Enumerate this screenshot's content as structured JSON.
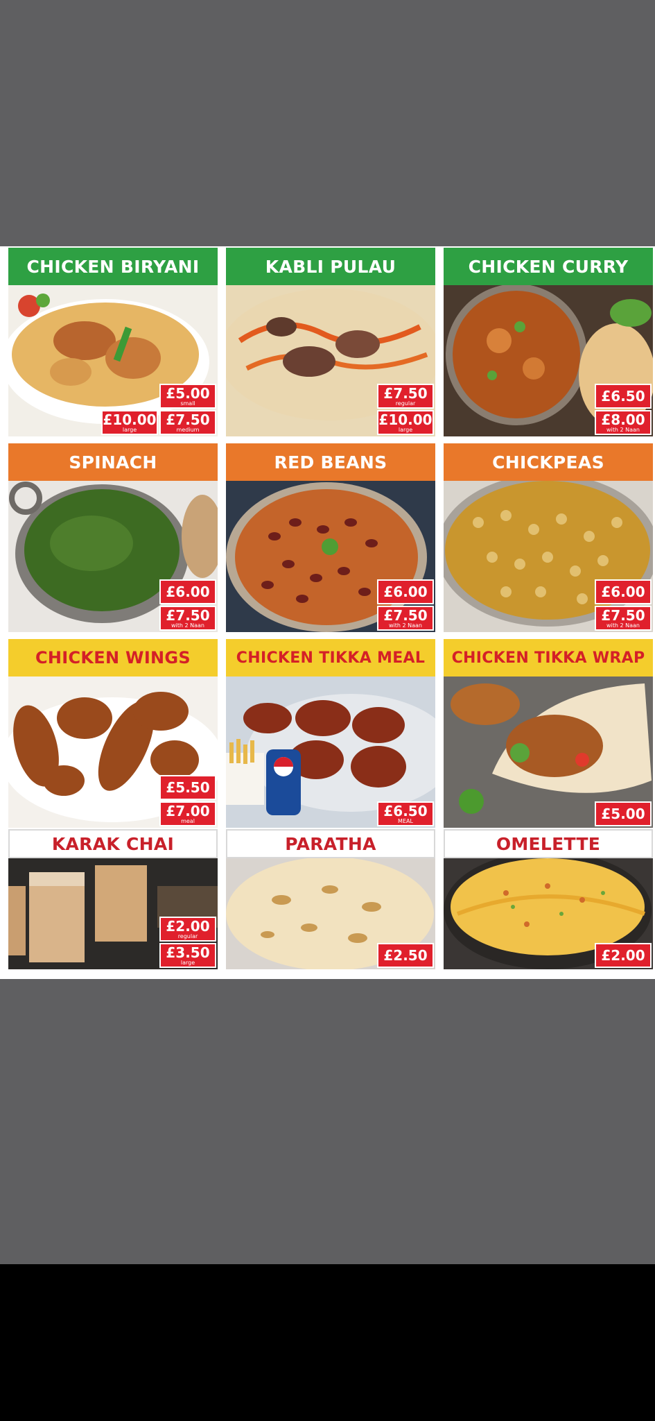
{
  "menu": {
    "items": [
      {
        "title": "CHICKEN BIRYANI",
        "prices": [
          {
            "amount": "£5.00",
            "note": "small"
          },
          {
            "amount": "£10.00",
            "note": "large"
          },
          {
            "amount": "£7.50",
            "note": "medium"
          }
        ]
      },
      {
        "title": "KABLI PULAU",
        "prices": [
          {
            "amount": "£7.50",
            "note": "regular"
          },
          {
            "amount": "£10.00",
            "note": "large"
          }
        ]
      },
      {
        "title": "CHICKEN CURRY",
        "prices": [
          {
            "amount": "£6.50",
            "note": ""
          },
          {
            "amount": "£8.00",
            "note": "with 2 Naan"
          }
        ]
      },
      {
        "title": "SPINACH",
        "prices": [
          {
            "amount": "£6.00",
            "note": ""
          },
          {
            "amount": "£7.50",
            "note": "with 2 Naan"
          }
        ]
      },
      {
        "title": "RED BEANS",
        "prices": [
          {
            "amount": "£6.00",
            "note": ""
          },
          {
            "amount": "£7.50",
            "note": "with 2 Naan"
          }
        ]
      },
      {
        "title": "CHICKPEAS",
        "prices": [
          {
            "amount": "£6.00",
            "note": ""
          },
          {
            "amount": "£7.50",
            "note": "with 2 Naan"
          }
        ]
      },
      {
        "title": "CHICKEN WINGS",
        "prices": [
          {
            "amount": "£5.50",
            "note": ""
          },
          {
            "amount": "£7.00",
            "note": "meal"
          }
        ]
      },
      {
        "title": "CHICKEN TIKKA MEAL",
        "prices": [
          {
            "amount": "£6.50",
            "note": "MEAL"
          }
        ]
      },
      {
        "title": "CHICKEN TIKKA WRAP",
        "prices": [
          {
            "amount": "£5.00",
            "note": ""
          }
        ]
      },
      {
        "title": "KARAK CHAI",
        "prices": [
          {
            "amount": "£2.00",
            "note": "regular"
          },
          {
            "amount": "£3.50",
            "note": "large"
          }
        ]
      },
      {
        "title": "PARATHA",
        "prices": [
          {
            "amount": "£2.50",
            "note": ""
          }
        ]
      },
      {
        "title": "OMELETTE",
        "prices": [
          {
            "amount": "£2.00",
            "note": ""
          }
        ]
      }
    ]
  },
  "colors": {
    "green_header": "#2ea043",
    "orange_header": "#e9782a",
    "yellow_header": "#f4cd2c",
    "price_red": "#e0202c",
    "background_gray": "#5f5f61"
  }
}
